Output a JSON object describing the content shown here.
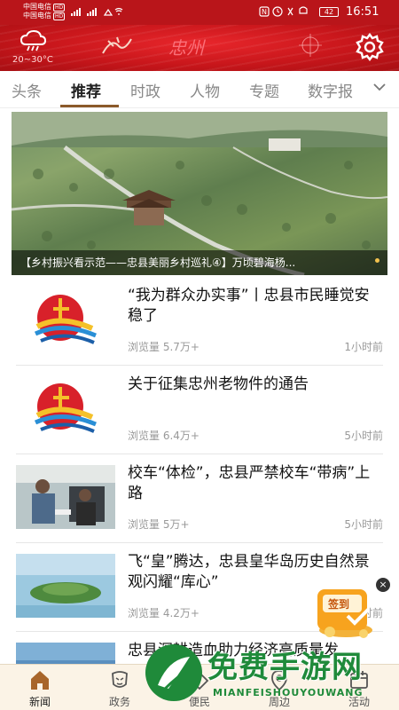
{
  "status_bar": {
    "carrier1": "中国电信",
    "carrier2": "中国电信",
    "hd": "HD",
    "signal": "⁴⁶ᵢₗ ⁴ᵢₗ",
    "battery": "42",
    "time": "16:51"
  },
  "header": {
    "weather_temp": "20~30°C",
    "logo_text": "忠州",
    "weather_icon": "weather-cloud-icon",
    "settings_icon": "gear-icon"
  },
  "tabs": {
    "items": [
      "头条",
      "推荐",
      "时政",
      "人物",
      "专题",
      "数字报"
    ],
    "active_index": 1,
    "more_icon": "chevron-down-icon"
  },
  "banner": {
    "caption": "【乡村振兴看示范——忠县美丽乡村巡礼④】万顷碧海杨..."
  },
  "news": [
    {
      "title": "“我为群众办实事”丨忠县市民睡觉安稳了",
      "views": "浏览量 5.7万+",
      "time": "1小时前"
    },
    {
      "title": "关于征集忠州老物件的通告",
      "views": "浏览量 6.4万+",
      "time": "5小时前"
    },
    {
      "title": "校车“体检”，忠县严禁校车“带病”上路",
      "views": "浏览量 5万+",
      "time": "5小时前"
    },
    {
      "title": "飞“皇”腾达，忠县皇华岛历史自然景观闪耀“库心”",
      "views": "浏览量 4.2万+",
      "time": "5小时前"
    },
    {
      "title": "忠县深耕造血助力经济高质量发",
      "views": "",
      "time": ""
    }
  ],
  "signin": {
    "label": "签到"
  },
  "bottom_nav": {
    "items": [
      {
        "label": "新闻",
        "icon": "home-icon"
      },
      {
        "label": "政务",
        "icon": "government-icon"
      },
      {
        "label": "便民",
        "icon": "service-icon"
      },
      {
        "label": "周边",
        "icon": "location-icon"
      },
      {
        "label": "活动",
        "icon": "activity-icon"
      }
    ]
  },
  "watermark": {
    "text": "免费手游网",
    "sub": "MIANFEISHOUYOUWANG"
  },
  "colors": {
    "brand_red": "#c8161b",
    "accent_brown": "#8b5a2b",
    "nav_bg": "#fbf3e6"
  }
}
